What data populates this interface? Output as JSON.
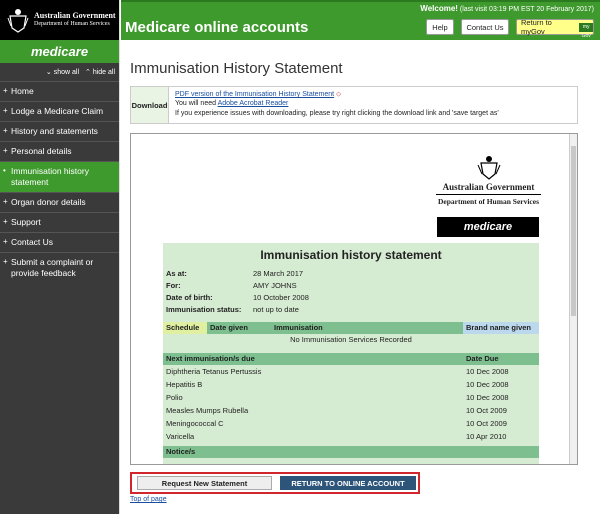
{
  "government": {
    "line1": "Australian Government",
    "line2": "Department of Human Services"
  },
  "brand": "medicare",
  "header": {
    "title": "Medicare online accounts",
    "welcome": "Welcome!",
    "last_visit": "(last visit 03:19 PM EST 20 February 2017)",
    "help": "Help",
    "contact": "Contact Us",
    "return_mygov": "Return to myGov",
    "mygov_logo": "my Gov"
  },
  "sidebar": {
    "show_all": "show all",
    "hide_all": "hide all",
    "items": [
      {
        "label": "Home",
        "icon": "plus-icon"
      },
      {
        "label": "Lodge a Medicare Claim",
        "icon": "plus-icon"
      },
      {
        "label": "History and statements",
        "icon": "plus-icon"
      },
      {
        "label": "Personal details",
        "icon": "plus-icon"
      },
      {
        "label": "Immunisation history statement",
        "icon": "dot-icon",
        "active": true
      },
      {
        "label": "Organ donor details",
        "icon": "plus-icon"
      },
      {
        "label": "Support",
        "icon": "plus-icon"
      },
      {
        "label": "Contact Us",
        "icon": "plus-icon"
      },
      {
        "label": "Submit a complaint or provide feedback",
        "icon": "plus-icon"
      }
    ]
  },
  "page": {
    "title": "Immunisation History Statement",
    "download": {
      "label": "Download",
      "pdf_link": "PDF version of the Immunisation History Statement",
      "need": "You will need ",
      "reader_link": "Adobe Acrobat Reader",
      "help": "If you experience issues with downloading, please try right clicking the download link and 'save target as'"
    }
  },
  "statement": {
    "dhs_line1": "Australian Government",
    "dhs_line2": "Department of Human Services",
    "brand": "medicare",
    "title": "Immunisation history statement",
    "as_at_label": "As at:",
    "as_at": "28 March 2017",
    "for_label": "For:",
    "for": "AMY  JOHNS",
    "dob_label": "Date of birth:",
    "dob": "10 October 2008",
    "status_label": "Immunisation status:",
    "status": "not up to date",
    "cols": {
      "schedule": "Schedule",
      "date_given": "Date given",
      "immunisation": "Immunisation",
      "brand": "Brand name given"
    },
    "no_records": "No Immunisation Services Recorded",
    "due_header": "Next immunisation/s due",
    "due_date_header": "Date Due",
    "due": [
      {
        "name": "Diphtheria Tetanus Pertussis",
        "date": "10 Dec 2008"
      },
      {
        "name": "Hepatitis B",
        "date": "10 Dec 2008"
      },
      {
        "name": "Polio",
        "date": "10 Dec 2008"
      },
      {
        "name": "Measles Mumps Rubella",
        "date": "10 Oct 2009"
      },
      {
        "name": "Meningococcal C",
        "date": "10 Oct 2009"
      },
      {
        "name": "Varicella",
        "date": "10 Apr 2010"
      }
    ],
    "notices": "Notice/s"
  },
  "actions": {
    "request": "Request New Statement",
    "return": "RETURN TO ONLINE ACCOUNT",
    "top": "Top of page"
  },
  "colors": {
    "brand_green": "#3f9a2e",
    "nav_dark": "#3a3a3a",
    "card_green": "#d6ecd2",
    "header_green": "#7dbf8e",
    "header_yellow": "#e0f0a0",
    "header_blue": "#bcd8ec",
    "button_blue": "#2d5479",
    "highlight_red": "#d0262c"
  }
}
